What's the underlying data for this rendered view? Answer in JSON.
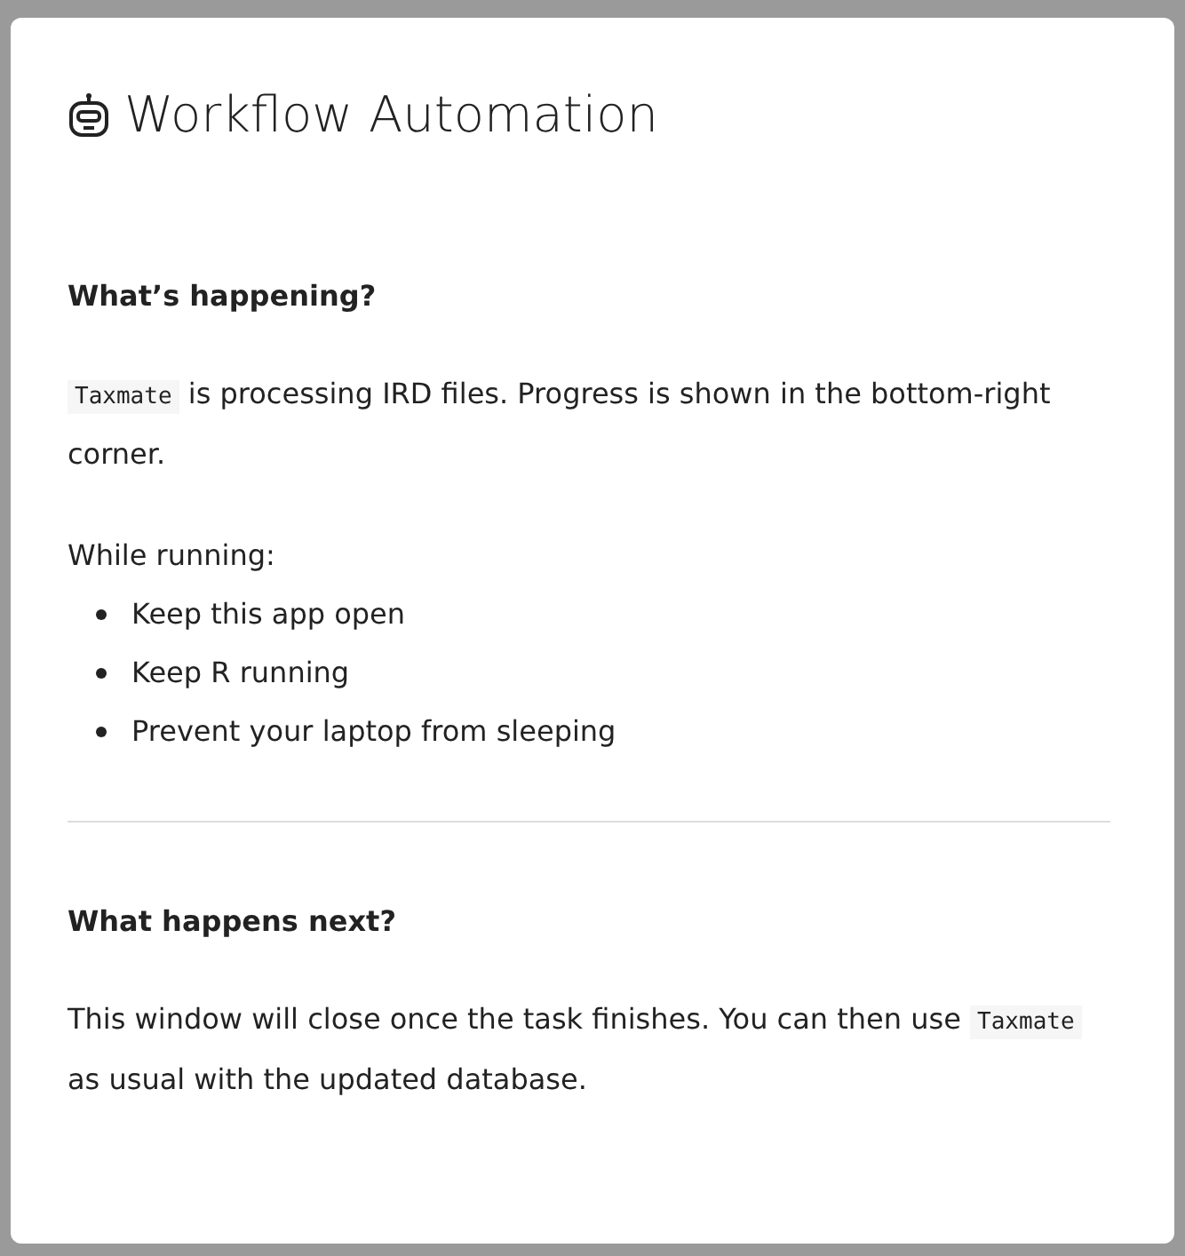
{
  "dialog": {
    "title": "Workflow Automation",
    "sections": [
      {
        "heading": "What’s happening?",
        "blocks": [
          {
            "kind": "paragraph",
            "segments": [
              {
                "kind": "code",
                "text": "Taxmate"
              },
              {
                "kind": "text",
                "text": " is processing IRD files. Progress is shown in the bottom-right corner."
              }
            ]
          },
          {
            "kind": "list",
            "intro": "While running:",
            "items": [
              "Keep this app open",
              "Keep R running",
              "Prevent your laptop from sleeping"
            ]
          }
        ]
      },
      {
        "heading": "What happens next?",
        "blocks": [
          {
            "kind": "paragraph",
            "segments": [
              {
                "kind": "text",
                "text": "This window will close once the task finishes. You can then use "
              },
              {
                "kind": "code",
                "text": "Taxmate"
              },
              {
                "kind": "text",
                "text": " as usual with the updated database."
              }
            ]
          }
        ]
      }
    ]
  }
}
